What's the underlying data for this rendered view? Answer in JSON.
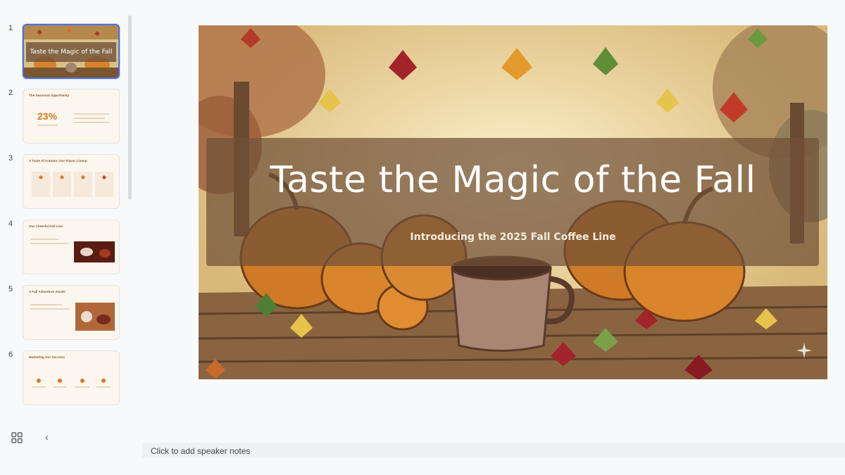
{
  "filmstrip": {
    "slides": [
      {
        "number": "1",
        "title": "Taste the Magic of the Fall"
      },
      {
        "number": "2",
        "title": "The Seasonal Opportunity",
        "stat": "23%"
      },
      {
        "number": "3",
        "title": "A Taste of Autumn: Our Flavor Lineup"
      },
      {
        "number": "4",
        "title": "Our Cheerful Fall Line"
      },
      {
        "number": "5",
        "title": "A Fall Adventure Awaits"
      },
      {
        "number": "6",
        "title": "Marketing Our Success"
      }
    ]
  },
  "slide": {
    "title": "Taste the Magic of the Fall",
    "subtitle": "Introducing the 2025 Fall Coffee Line"
  },
  "notes": {
    "placeholder": "Click to add speaker notes"
  },
  "colors": {
    "accent": "#4a6fd8",
    "title_band": "#705037"
  }
}
